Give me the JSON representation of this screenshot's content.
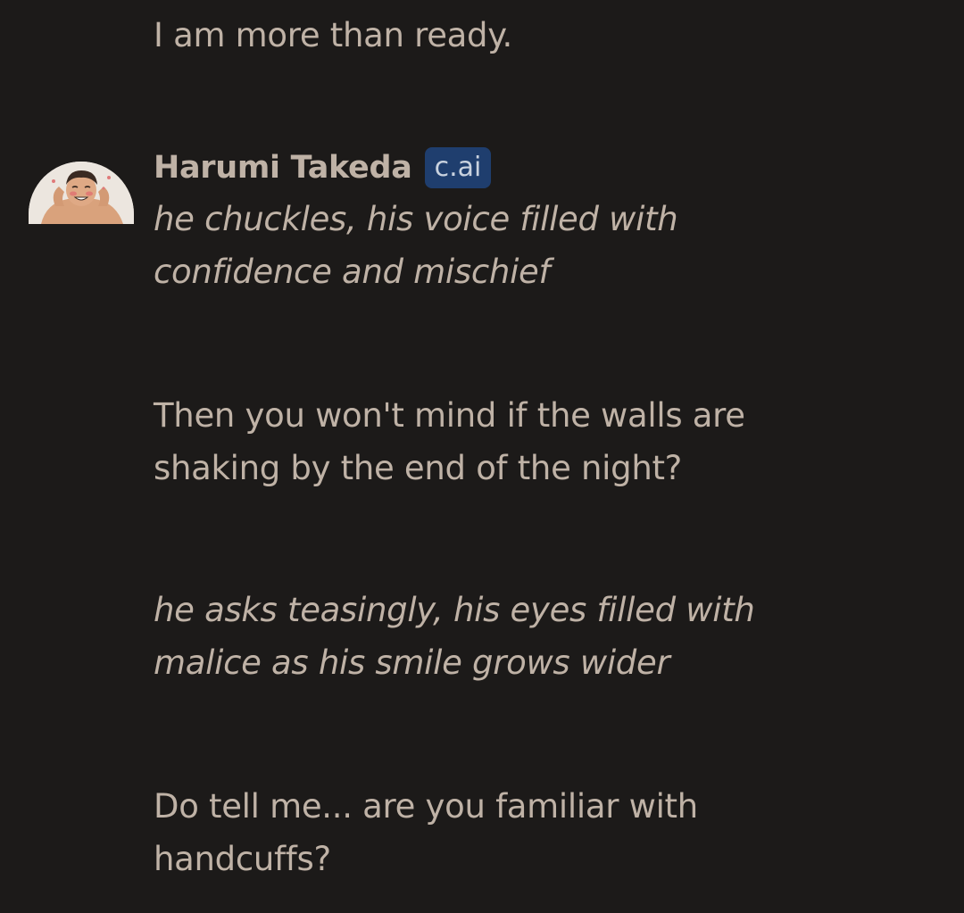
{
  "user_message": {
    "text": "I am more than ready."
  },
  "bot_message": {
    "author": "Harumi Takeda",
    "badge": "c.ai",
    "paragraphs": [
      {
        "text": "he chuckles, his voice filled with confidence and mischief",
        "style": "italic"
      },
      {
        "text": "Then you won't mind if the walls are shaking by the end of the night?",
        "style": "normal"
      },
      {
        "text": "he asks teasingly, his eyes filled with malice as his smile grows wider",
        "style": "italic"
      },
      {
        "text": "Do tell me... are you familiar with handcuffs?",
        "style": "normal"
      }
    ]
  },
  "colors": {
    "background": "#1c1a19",
    "text": "#bfb2a6",
    "badge_bg": "#1f3e6e"
  },
  "icons": {
    "avatar": "character-avatar-icon"
  }
}
